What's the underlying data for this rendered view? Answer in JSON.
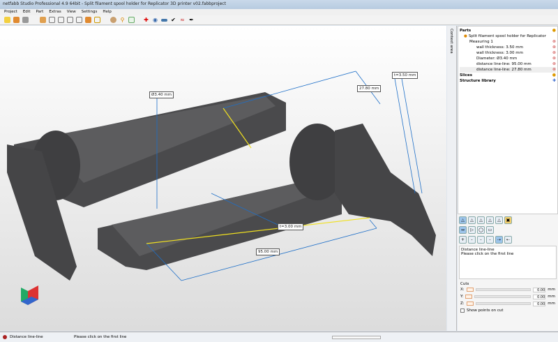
{
  "window": {
    "title": "netfabb Studio Professional 4.9 64bit - Split filament spool holder for Replicator 3D printer v02.fabbproject"
  },
  "menu": [
    "Project",
    "Edit",
    "Part",
    "Extras",
    "View",
    "Settings",
    "Help"
  ],
  "toolbar_icons": [
    "new-project-icon",
    "add-part-icon",
    "settings-gear-icon",
    "view-cube-front-icon",
    "view-cube-back-icon",
    "view-cube-left-icon",
    "view-cube-right-icon",
    "view-cube-top-icon",
    "view-cube-bottom-icon",
    "view-cube-iso-icon",
    "sphere-icon",
    "zoom-icon",
    "select-icon",
    "repair-icon",
    "measure-icon",
    "ruler-icon",
    "check-icon",
    "cut-icon",
    "pen-icon"
  ],
  "viewport": {
    "labels": {
      "diameter": "Ø3.40 mm",
      "distance_short": "27.80 mm",
      "thickness_right": "t=3.50 mm",
      "thickness_mid": "t=3.00 mm",
      "distance_long": "95.00 mm"
    }
  },
  "side_tab": "Context area",
  "tree": {
    "parts": "Parts",
    "part_name": "Split filament spool holder for Replicator",
    "measuring": "Measuring 1",
    "items": [
      "wall thickness: 3.50 mm",
      "wall thickness: 3.00 mm",
      "Diameter: Ø3.40 mm",
      "distance line-line: 95.00 mm",
      "distance line-line: 27.80 mm"
    ],
    "slices": "Slices",
    "structure_library": "Structure library"
  },
  "message": {
    "title": "Distance line-line",
    "text": "Please click on the first line"
  },
  "cuts": {
    "title": "Cuts",
    "rows": [
      {
        "axis": "X:",
        "value": "0.00",
        "unit": "mm"
      },
      {
        "axis": "Y:",
        "value": "0.00",
        "unit": "mm"
      },
      {
        "axis": "Z:",
        "value": "0.00",
        "unit": "mm"
      }
    ],
    "show_points": "Show points on cut"
  },
  "status": {
    "mode": "Distance line-line",
    "hint": "Please click on the first line"
  },
  "colors": {
    "measure_line": "#1e6fc8",
    "highlight": "#f0e020",
    "model": "#4a4a4c"
  }
}
